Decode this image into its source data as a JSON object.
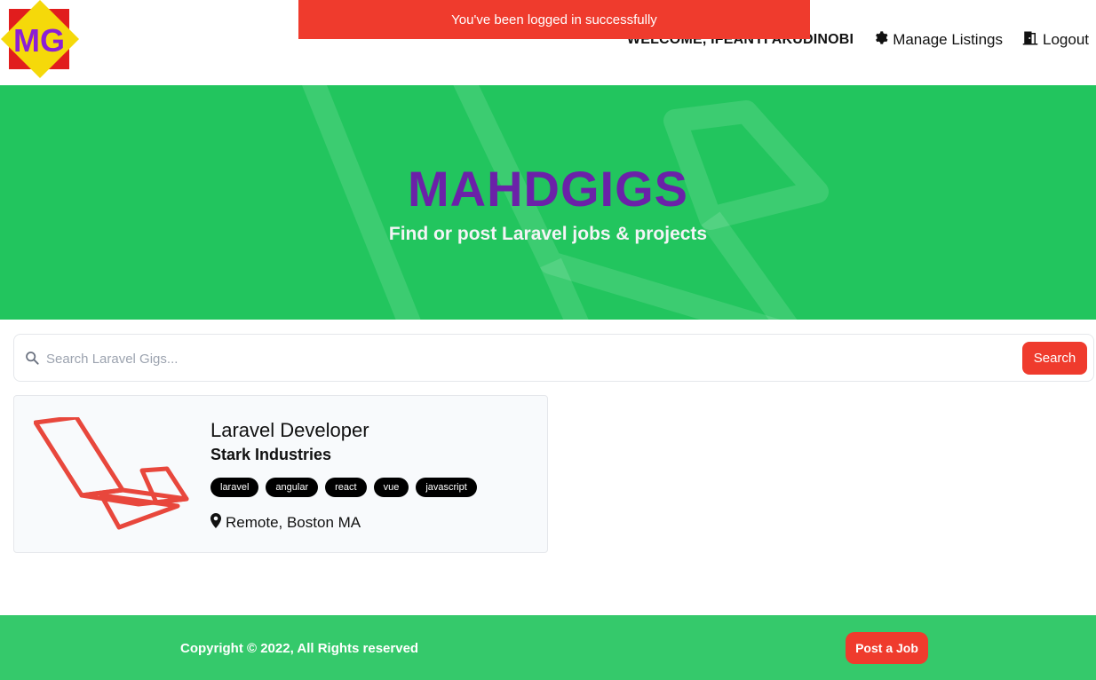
{
  "flash": {
    "message": "You've been logged in successfully"
  },
  "header": {
    "logo_text": "MG",
    "welcome": "WELCOME, IFEANYI AKUDINOBI",
    "manage_listings": "Manage Listings",
    "logout": "Logout"
  },
  "hero": {
    "title": "MAHDGIGS",
    "subtitle": "Find or post Laravel jobs & projects"
  },
  "search": {
    "placeholder": "Search Laravel Gigs...",
    "button_label": "Search"
  },
  "listings": [
    {
      "title": "Laravel Developer",
      "company": "Stark Industries",
      "tags": [
        "laravel",
        "angular",
        "react",
        "vue",
        "javascript"
      ],
      "location": "Remote, Boston MA"
    }
  ],
  "footer": {
    "copyright": "Copyright © 2022, All Rights reserved",
    "post_job": "Post a Job"
  },
  "colors": {
    "brand_green": "#22c55e",
    "accent_red": "#ef3b2d",
    "title_purple": "#6b21a8",
    "logo_yellow": "#f5d90a",
    "logo_red": "#e11d1d"
  },
  "icons": {
    "manage": "gear-icon",
    "logout": "door-icon",
    "search": "search-icon",
    "location": "map-pin-icon",
    "listing": "laravel-logo-icon"
  }
}
